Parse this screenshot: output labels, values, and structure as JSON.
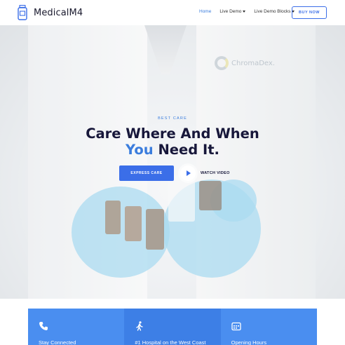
{
  "brand": {
    "name": "MedicalM4",
    "logo_icon": "pill-bottle-icon"
  },
  "nav": {
    "items": [
      {
        "label": "Home",
        "active": true,
        "has_caret": false
      },
      {
        "label": "Live Demo",
        "active": false,
        "has_caret": true
      },
      {
        "label": "Live Demo Blocks",
        "active": false,
        "has_caret": true
      }
    ],
    "cta_label": "BUY NOW"
  },
  "hero": {
    "tagline": "BEST CARE",
    "title_line1": "Care Where And When",
    "title_accent": "You",
    "title_rest": "Need It.",
    "primary_button": "EXPRESS CARE",
    "video_label": "WATCH VIDEO",
    "background_brand_text": "ChromaDex."
  },
  "features": [
    {
      "label": "Stay Connected",
      "icon": "phone-icon"
    },
    {
      "label": "#1 Hospital on the West Coast",
      "icon": "walking-person-icon"
    },
    {
      "label": "Opening Hours",
      "icon": "calendar-card-icon"
    }
  ],
  "colors": {
    "accent": "#3b7ddd",
    "button": "#3b6ee8",
    "feature_bg": "#4a8ef0",
    "title": "#17173a"
  }
}
